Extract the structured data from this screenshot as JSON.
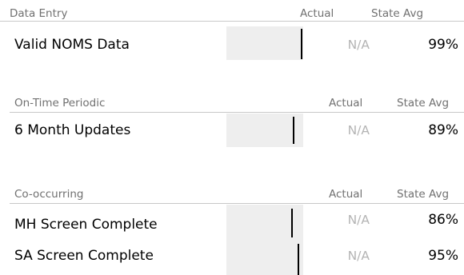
{
  "sections": [
    {
      "title": "Data Entry",
      "col_actual": "Actual",
      "col_state_avg": "State Avg",
      "rows": [
        {
          "label": "Valid NOMS Data",
          "actual": "N/A",
          "state_avg": "99%",
          "marker_fraction": 0.99
        }
      ]
    },
    {
      "title": "On-Time Periodic",
      "col_actual": "Actual",
      "col_state_avg": "State Avg",
      "rows": [
        {
          "label": "6 Month Updates",
          "actual": "N/A",
          "state_avg": "89%",
          "marker_fraction": 0.89
        }
      ]
    },
    {
      "title": "Co-occurring",
      "col_actual": "Actual",
      "col_state_avg": "State Avg",
      "rows": [
        {
          "label": "MH Screen Complete",
          "actual": "N/A",
          "state_avg": "86%",
          "marker_fraction": 0.86
        },
        {
          "label": "SA Screen Complete",
          "actual": "N/A",
          "state_avg": "95%",
          "marker_fraction": 0.95
        }
      ]
    }
  ]
}
